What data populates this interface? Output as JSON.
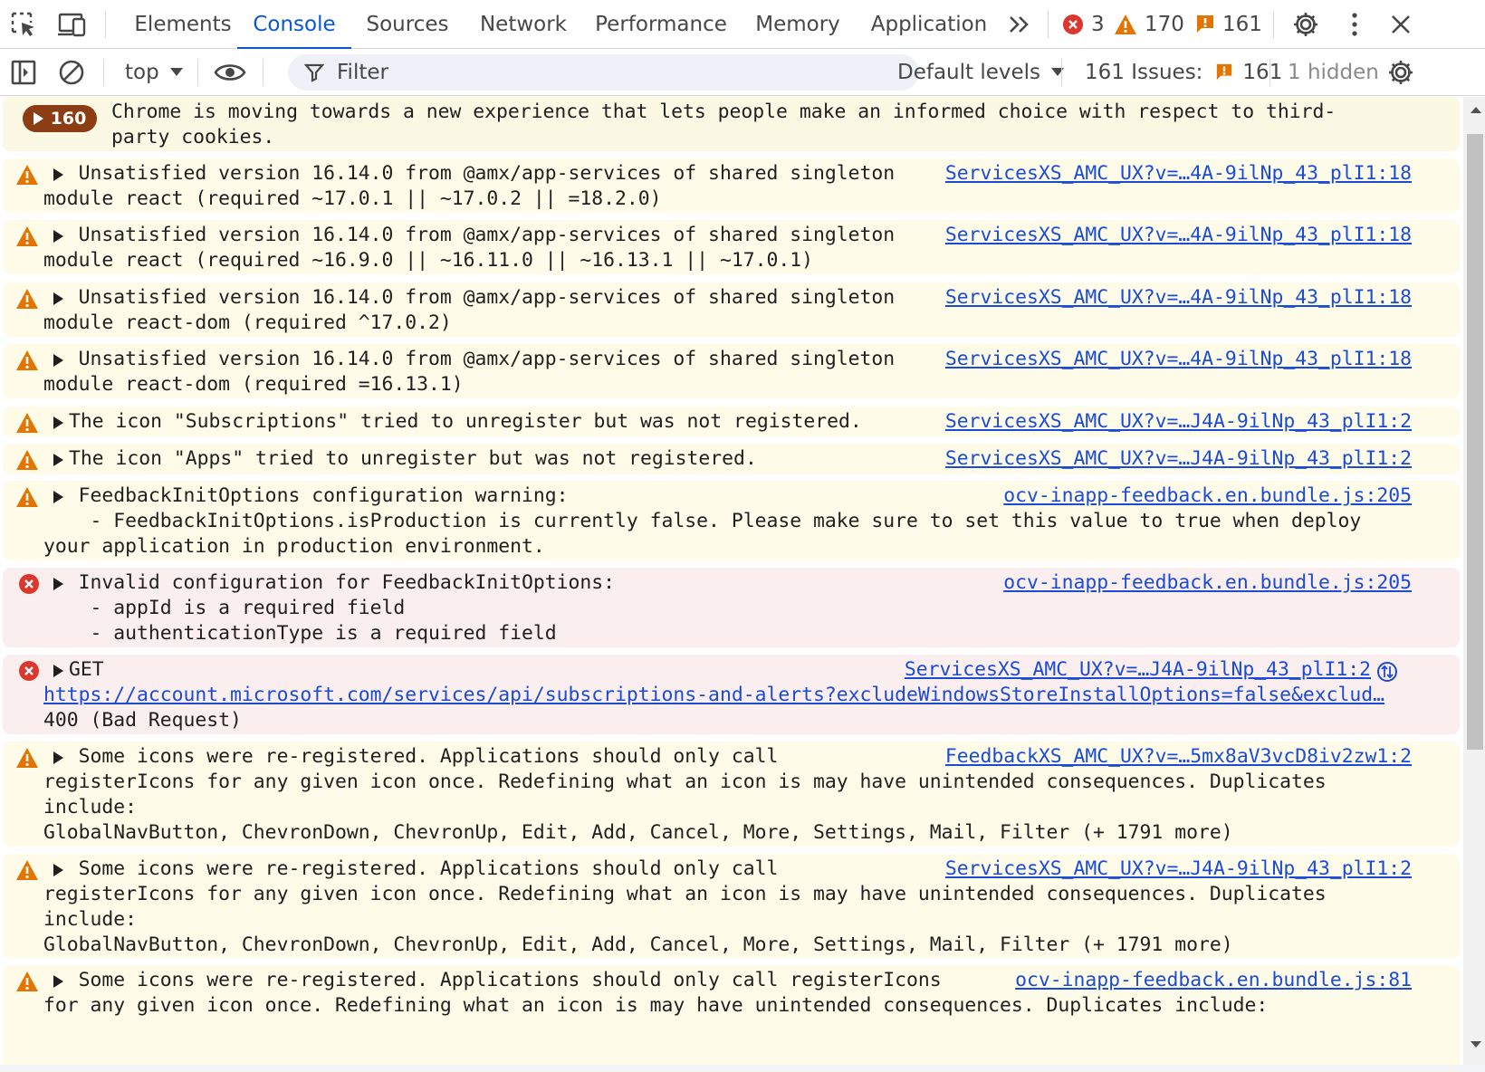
{
  "tabs": [
    {
      "label": "Elements"
    },
    {
      "label": "Console",
      "active": true
    },
    {
      "label": "Sources"
    },
    {
      "label": "Network"
    },
    {
      "label": "Performance"
    },
    {
      "label": "Memory"
    },
    {
      "label": "Application"
    }
  ],
  "counts": {
    "errors": "3",
    "warnings": "170",
    "issues": "161"
  },
  "toolbar": {
    "context": "top",
    "filter_placeholder": "Filter",
    "levels": "Default levels",
    "issues_label": "161 Issues:",
    "issues_count": "161",
    "hidden": "1 hidden"
  },
  "banner": {
    "count": "160",
    "text": "Chrome is moving towards a new experience that lets people make an informed choice with respect to third-\nparty cookies."
  },
  "messages": [
    {
      "type": "warning",
      "text": "Unsatisfied version 16.14.0 from @amx/app-services of shared singleton\nmodule react (required ~17.0.1 || ~17.0.2 || =18.2.0)",
      "source": "ServicesXS_AMC_UX?v=…4A-9ilNp_43_plI1:18"
    },
    {
      "type": "warning",
      "text": "Unsatisfied version 16.14.0 from @amx/app-services of shared singleton\nmodule react (required ~16.9.0 || ~16.11.0 || ~16.13.1 || ~17.0.1)",
      "source": "ServicesXS_AMC_UX?v=…4A-9ilNp_43_plI1:18"
    },
    {
      "type": "warning",
      "text": "Unsatisfied version 16.14.0 from @amx/app-services of shared singleton\nmodule react-dom (required ^17.0.2)",
      "source": "ServicesXS_AMC_UX?v=…4A-9ilNp_43_plI1:18"
    },
    {
      "type": "warning",
      "text": "Unsatisfied version 16.14.0 from @amx/app-services of shared singleton\nmodule react-dom (required =16.13.1)",
      "source": "ServicesXS_AMC_UX?v=…4A-9ilNp_43_plI1:18"
    },
    {
      "type": "warning",
      "text": "The icon \"Subscriptions\" tried to unregister but was not registered.",
      "source": "ServicesXS_AMC_UX?v=…J4A-9ilNp_43_plI1:2"
    },
    {
      "type": "warning",
      "text": "The icon \"Apps\" tried to unregister but was not registered.",
      "source": "ServicesXS_AMC_UX?v=…J4A-9ilNp_43_plI1:2"
    },
    {
      "type": "warning",
      "text": "FeedbackInitOptions configuration warning:\n    - FeedbackInitOptions.isProduction is currently false. Please make sure to set this value to true when deploy\nyour application in production environment.",
      "source": "ocv-inapp-feedback.en.bundle.js:205"
    },
    {
      "type": "error",
      "text": "Invalid configuration for FeedbackInitOptions:\n    - appId is a required field\n    - authenticationType is a required field",
      "source": "ocv-inapp-feedback.en.bundle.js:205"
    },
    {
      "type": "error",
      "text": "GET",
      "url": "https://account.microsoft.com/services/api/subscriptions-and-alerts?excludeWindowsStoreInstallOptions=false&exclud…",
      "status": "400 (Bad Request)",
      "source": "ServicesXS_AMC_UX?v=…J4A-9ilNp_43_plI1:2"
    },
    {
      "type": "warning",
      "text": "Some icons were re-registered. Applications should only call\nregisterIcons for any given icon once. Redefining what an icon is may have unintended consequences. Duplicates\ninclude:\nGlobalNavButton, ChevronDown, ChevronUp, Edit, Add, Cancel, More, Settings, Mail, Filter (+ 1791 more)",
      "source": "FeedbackXS_AMC_UX?v=…5mx8aV3vcD8iv2zw1:2"
    },
    {
      "type": "warning",
      "text": "Some icons were re-registered. Applications should only call\nregisterIcons for any given icon once. Redefining what an icon is may have unintended consequences. Duplicates\ninclude:\nGlobalNavButton, ChevronDown, ChevronUp, Edit, Add, Cancel, More, Settings, Mail, Filter (+ 1791 more)",
      "source": "ServicesXS_AMC_UX?v=…J4A-9ilNp_43_plI1:2"
    },
    {
      "type": "warning",
      "text": "Some icons were re-registered. Applications should only call registerIcons\nfor any given icon once. Redefining what an icon is may have unintended consequences. Duplicates include:",
      "source": "ocv-inapp-feedback.en.bundle.js:81"
    }
  ],
  "colors": {
    "accent": "#0b57d0",
    "error": "#dc362e",
    "warning": "#e37400",
    "link": "#1a4bd6"
  }
}
